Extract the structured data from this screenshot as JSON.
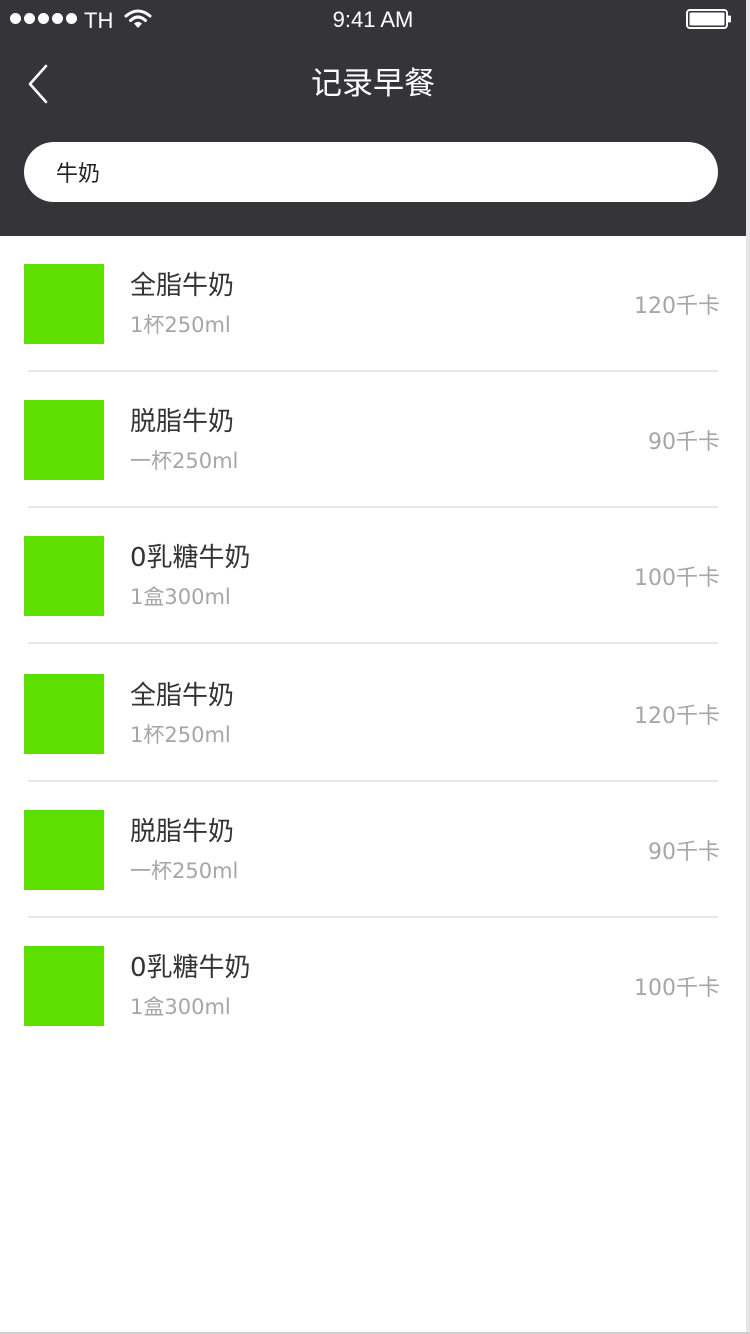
{
  "status_bar": {
    "carrier": "TH",
    "time": "9:41 AM"
  },
  "nav": {
    "title": "记录早餐",
    "back_icon": "chevron-left-icon"
  },
  "search": {
    "value": "牛奶"
  },
  "colors": {
    "header_bg": "#353439",
    "thumbnail": "#5ddf00"
  },
  "items": [
    {
      "name": "全脂牛奶",
      "portion": "1杯250ml",
      "calories": "120千卡"
    },
    {
      "name": "脱脂牛奶",
      "portion": "一杯250ml",
      "calories": "90千卡"
    },
    {
      "name": "0乳糖牛奶",
      "portion": "1盒300ml",
      "calories": "100千卡"
    },
    {
      "name": "全脂牛奶",
      "portion": "1杯250ml",
      "calories": "120千卡"
    },
    {
      "name": "脱脂牛奶",
      "portion": "一杯250ml",
      "calories": "90千卡"
    },
    {
      "name": "0乳糖牛奶",
      "portion": "1盒300ml",
      "calories": "100千卡"
    }
  ]
}
